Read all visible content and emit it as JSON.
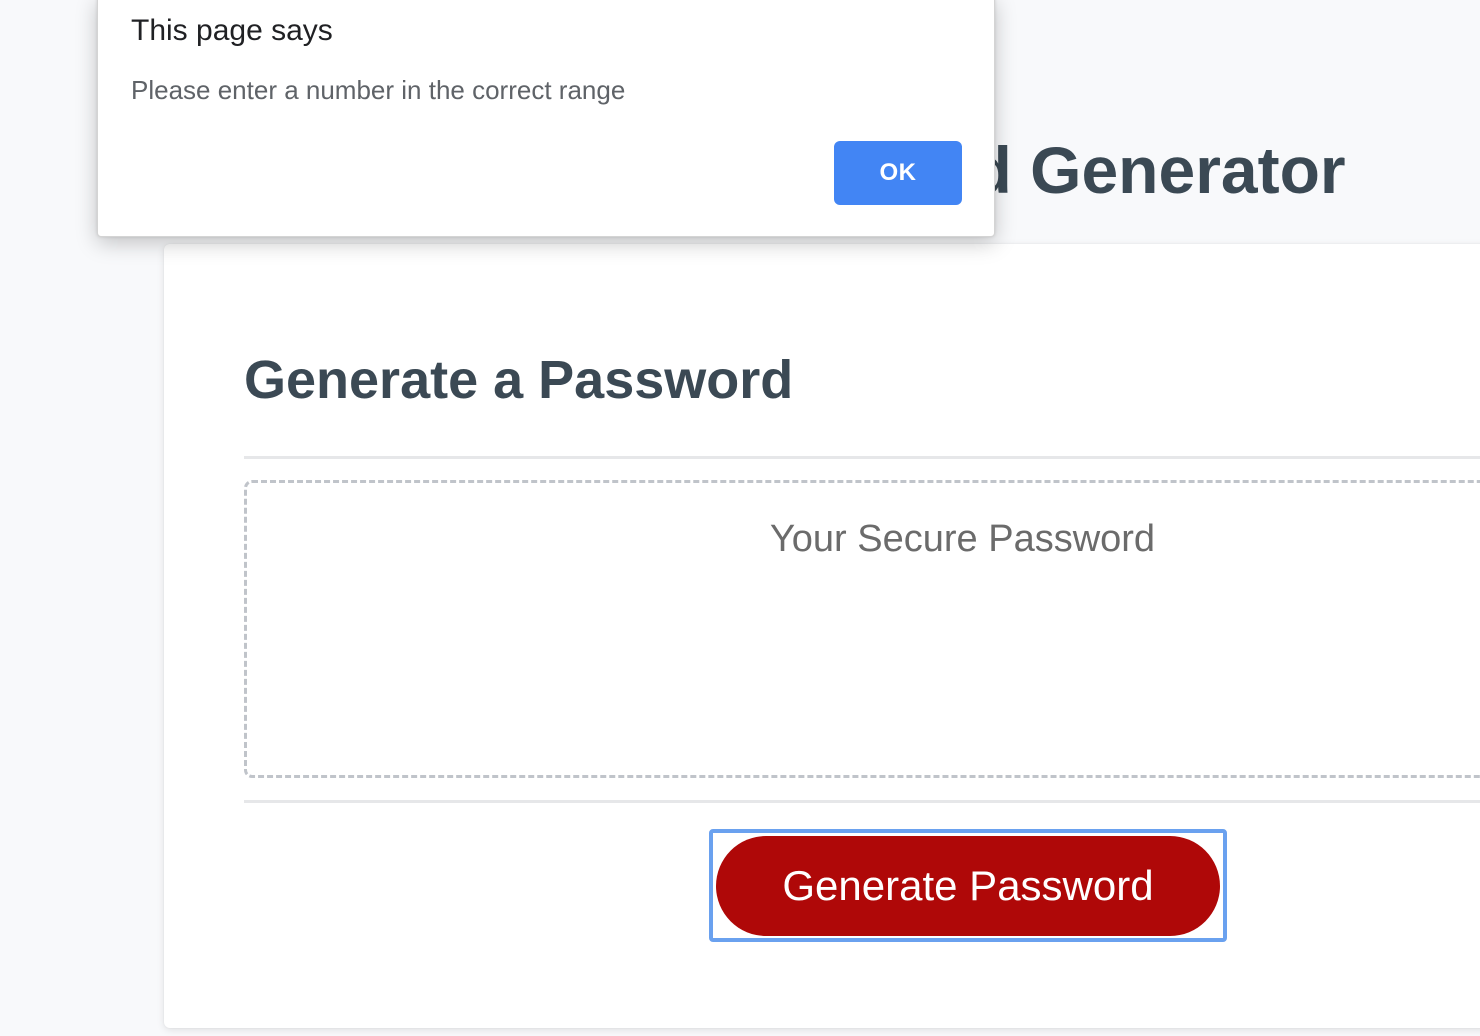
{
  "page": {
    "heading": "Password Generator"
  },
  "card": {
    "title": "Generate a Password",
    "password_placeholder": "Your Secure Password",
    "generate_button_label": "Generate Password"
  },
  "dialog": {
    "title": "This page says",
    "message": "Please enter a number in the correct range",
    "ok_label": "OK"
  },
  "colors": {
    "heading_text": "#3a4a57",
    "generate_button": "#b10808",
    "ok_button": "#4285f4",
    "focus_ring": "#6aa1ef",
    "page_background": "#f8f9fb"
  }
}
